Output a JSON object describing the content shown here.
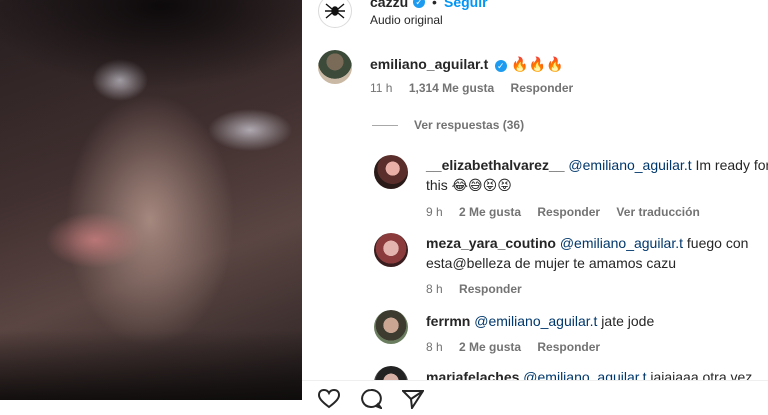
{
  "post": {
    "author": "cazzu",
    "follow_label": "Seguir",
    "separator": "•",
    "audio": "Audio original",
    "verified_icon": "✓"
  },
  "comments": [
    {
      "user": "emiliano_aguilar.t",
      "text": "🔥🔥🔥",
      "time": "11 h",
      "likes": "1,314 Me gusta",
      "reply": "Responder",
      "view_replies": "Ver respuestas (36)"
    },
    {
      "user": "__elizabethalvarez__",
      "mention": "@emiliano_aguilar.t",
      "text1": " Im ready for",
      "text2": "this 😂😅😝😝",
      "time": "9 h",
      "likes": "2 Me gusta",
      "reply": "Responder",
      "translate": "Ver traducción"
    },
    {
      "user": "meza_yara_coutino",
      "mention": "@emiliano_aguilar.t",
      "text1": " fuego con",
      "text2": "esta@belleza de mujer te amamos cazu",
      "time": "8 h",
      "reply": "Responder"
    },
    {
      "user": "ferrmn",
      "mention": "@emiliano_aguilar.t",
      "text1": " jate jode",
      "time": "8 h",
      "likes": "2 Me gusta",
      "reply": "Responder"
    },
    {
      "user": "mariafelaches",
      "mention": "@emiliano_aguilar.t",
      "text1": " jajajaaa otra vez"
    }
  ],
  "icons": {
    "author_avatar": "spider-logo",
    "like": "heart-icon",
    "comment": "comment-icon",
    "share": "share-icon"
  }
}
